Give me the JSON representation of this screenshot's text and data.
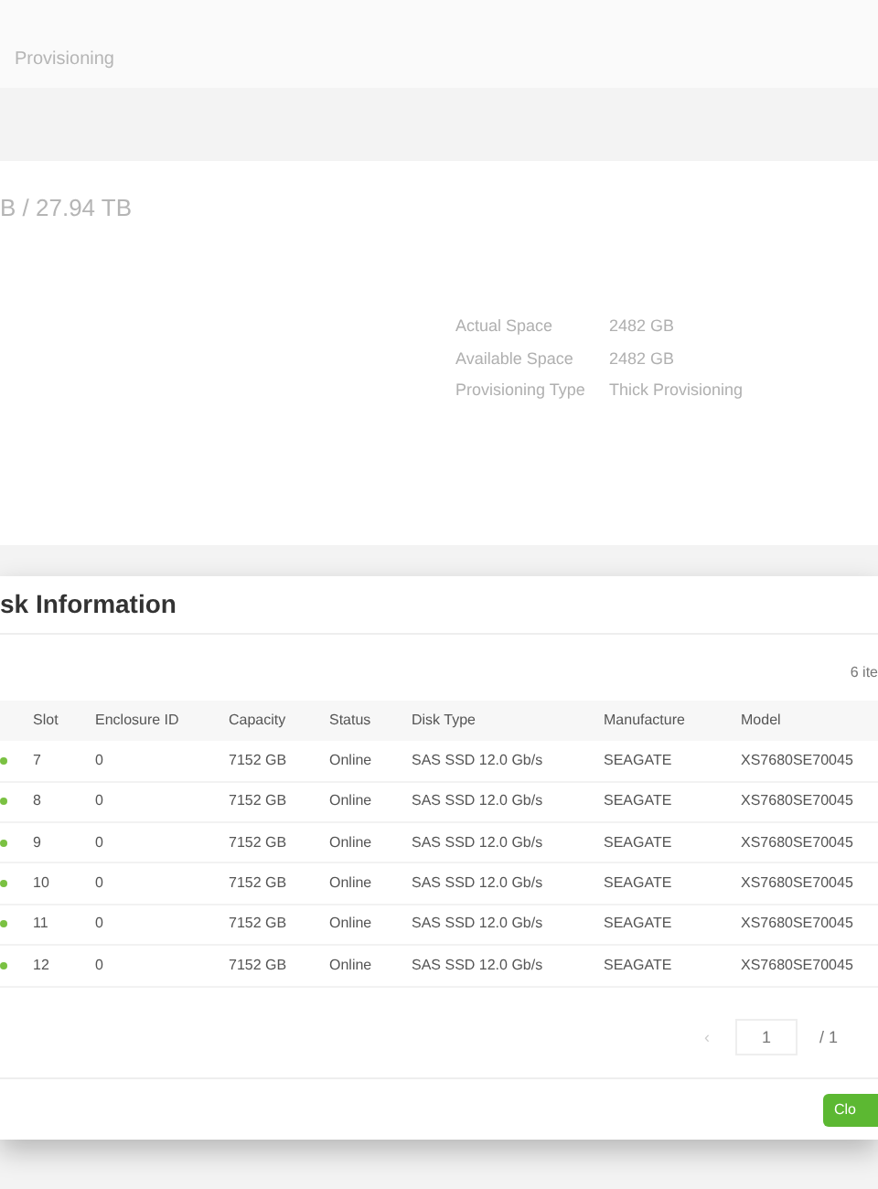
{
  "background": {
    "tab": "Provisioning",
    "capacity": "B / 27.94 TB",
    "details": [
      {
        "label": "Actual Space",
        "value": "2482 GB"
      },
      {
        "label": "Available Space",
        "value": "2482 GB"
      },
      {
        "label": "Provisioning Type",
        "value": "Thick Provisioning"
      }
    ]
  },
  "dialog": {
    "title": "sk Information",
    "count": "6 ite",
    "columns": [
      "Slot",
      "Enclosure ID",
      "Capacity",
      "Status",
      "Disk Type",
      "Manufacture",
      "Model"
    ],
    "rows": [
      {
        "color": "#7ac142",
        "cells": [
          "7",
          "0",
          "7152 GB",
          "Online",
          "SAS SSD 12.0 Gb/s",
          "SEAGATE",
          "XS7680SE70045"
        ]
      },
      {
        "color": "#7ac142",
        "cells": [
          "8",
          "0",
          "7152 GB",
          "Online",
          "SAS SSD 12.0 Gb/s",
          "SEAGATE",
          "XS7680SE70045"
        ]
      },
      {
        "color": "#7ac142",
        "cells": [
          "9",
          "0",
          "7152 GB",
          "Online",
          "SAS SSD 12.0 Gb/s",
          "SEAGATE",
          "XS7680SE70045"
        ]
      },
      {
        "color": "#7ac142",
        "cells": [
          "10",
          "0",
          "7152 GB",
          "Online",
          "SAS SSD 12.0 Gb/s",
          "SEAGATE",
          "XS7680SE70045"
        ]
      },
      {
        "color": "#7ac142",
        "cells": [
          "11",
          "0",
          "7152 GB",
          "Online",
          "SAS SSD 12.0 Gb/s",
          "SEAGATE",
          "XS7680SE70045"
        ]
      },
      {
        "color": "#7ac142",
        "cells": [
          "12",
          "0",
          "7152 GB",
          "Online",
          "SAS SSD 12.0 Gb/s",
          "SEAGATE",
          "XS7680SE70045"
        ]
      }
    ],
    "pagination": {
      "prev": "‹",
      "page": "1",
      "total": "/ 1"
    },
    "close_button": "Clo"
  }
}
